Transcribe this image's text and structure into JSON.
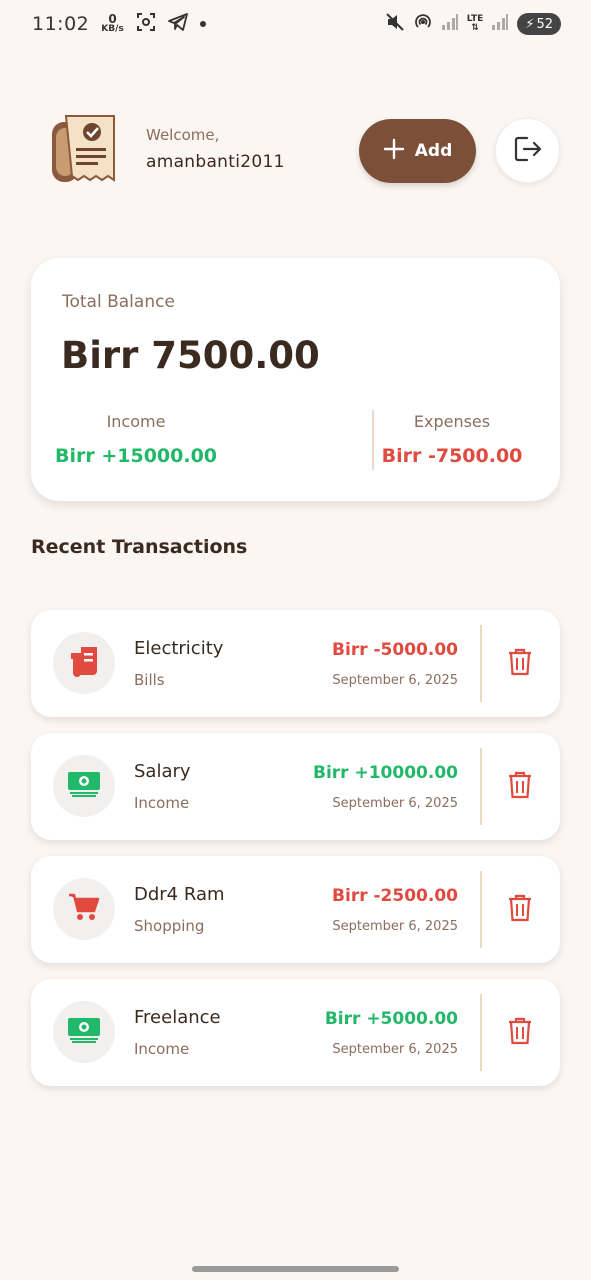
{
  "status_bar": {
    "time": "11:02",
    "net_speed_value": "0",
    "net_speed_unit": "KB/s",
    "lte": "LTE",
    "battery": "52"
  },
  "header": {
    "welcome_label": "Welcome,",
    "username": "amanbanti2011",
    "add_label": "Add"
  },
  "balance": {
    "label": "Total Balance",
    "amount": "Birr 7500.00",
    "income_label": "Income",
    "income_value": "Birr +15000.00",
    "expenses_label": "Expenses",
    "expenses_value": "Birr -7500.00"
  },
  "recent_title": "Recent Transactions",
  "transactions": [
    {
      "title": "Electricity",
      "category": "Bills",
      "amount": "Birr -5000.00",
      "date": "September 6, 2025",
      "type": "expense",
      "icon": "receipt-icon"
    },
    {
      "title": "Salary",
      "category": "Income",
      "amount": "Birr +10000.00",
      "date": "September 6, 2025",
      "type": "income",
      "icon": "money-icon"
    },
    {
      "title": "Ddr4 Ram",
      "category": "Shopping",
      "amount": "Birr -2500.00",
      "date": "September 6, 2025",
      "type": "expense",
      "icon": "cart-icon"
    },
    {
      "title": "Freelance",
      "category": "Income",
      "amount": "Birr +5000.00",
      "date": "September 6, 2025",
      "type": "income",
      "icon": "money-icon"
    }
  ],
  "colors": {
    "accent": "#7b4f38",
    "income": "#22b869",
    "expense": "#e04a3f",
    "background": "#fcf6f2"
  }
}
